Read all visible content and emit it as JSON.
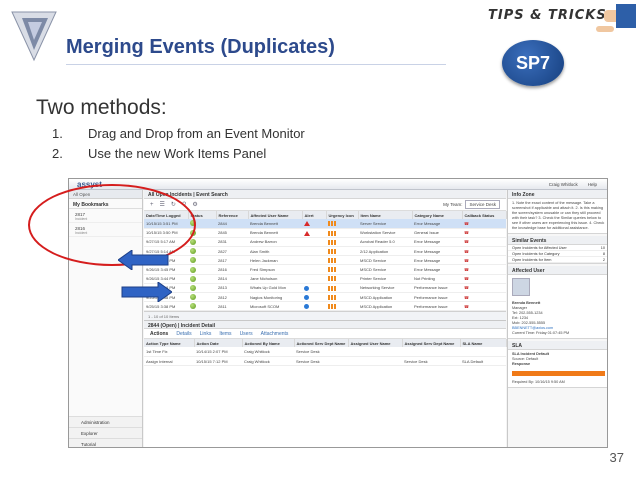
{
  "slide": {
    "title": "Merging Events (Duplicates)",
    "tips_label": "TIPS & TRICKS",
    "badge": "SP7",
    "subtitle": "Two methods:",
    "methods": [
      {
        "num": "1.",
        "text": "Drag and Drop from an Event Monitor"
      },
      {
        "num": "2.",
        "text": "Use the new Work Items Panel"
      }
    ],
    "page_number": "37"
  },
  "app": {
    "brand": "assyst",
    "user": "Craig Whitlock",
    "help": "Help",
    "left": {
      "header": "All Open",
      "bookmarks_label": "My Bookmarks",
      "saved": [
        {
          "name": "2817",
          "sub": "Incident"
        },
        {
          "name": "2816",
          "sub": "Incident"
        }
      ],
      "bottom": [
        "Administration",
        "Explorer",
        "Tutorial"
      ]
    },
    "center": {
      "title": "All Open Incidents | Event Search",
      "team_label": "My Team:",
      "team_value": "Service Desk",
      "columns": [
        "Date/Time Logged",
        "Status",
        "Reference",
        "Affected User Name",
        "Alert",
        "Urgency Icon",
        "Item Name",
        "Category Name",
        "Callback Status"
      ],
      "rows": [
        [
          "10/15/15 3:51 PM",
          "",
          "2844",
          "Brenda Bennett",
          "warn",
          "bars",
          "Server Service",
          "Error Message",
          "cb"
        ],
        [
          "10/15/15 3:50 PM",
          "",
          "2845",
          "Brenda Bennett",
          "warn",
          "bars",
          "Workstation Service",
          "General Issue",
          "cb"
        ],
        [
          "9/27/15 5:17 AM",
          "",
          "2831",
          "Andrew Barron",
          "",
          "bars",
          "Acrobat Reader 5.0",
          "Error Message",
          "cb"
        ],
        [
          "9/27/15 5:14 AM",
          "",
          "2827",
          "Alan Smith",
          "",
          "bars",
          "2/12 Application",
          "Error Message",
          "cb"
        ],
        [
          "9/26/15 3:49 PM",
          "",
          "2817",
          "Helen Jackman",
          "",
          "bars",
          "MSCD Service",
          "Error Message",
          "cb"
        ],
        [
          "9/26/15 3:45 PM",
          "",
          "2816",
          "Fred Simpson",
          "",
          "bars",
          "MSCD Service",
          "Error Message",
          "cb"
        ],
        [
          "9/26/15 3:44 PM",
          "",
          "2814",
          "Jane Nicholson",
          "",
          "bars",
          "Printer Service",
          "Not Printing",
          "cb"
        ],
        [
          "9/25/15 3:38 PM",
          "",
          "2813",
          "Whats Up Gold Mon",
          "info",
          "bars",
          "Networking Service",
          "Performance Issue",
          "cb"
        ],
        [
          "9/25/15 3:38 PM",
          "",
          "2812",
          "Nagios Monitoring",
          "info",
          "bars",
          "MSCD Application",
          "Performance Issue",
          "cb"
        ],
        [
          "9/25/15 3:38 PM",
          "",
          "2811",
          "Microsoft SCOM",
          "info",
          "bars",
          "MSCD Application",
          "Performance Issue",
          "cb"
        ]
      ],
      "pager": "1 - 10 of 10 Items",
      "detail_title": "2844 (Open) | Incident Detail",
      "tabs": [
        "Actions",
        "Details",
        "Links",
        "Items",
        "Users",
        "Attachments"
      ],
      "action_columns": [
        "Action Type Name",
        "Action Date",
        "Actioned By Name",
        "Actioned Serv Dept Name",
        "Assigned User Name",
        "Assigned Serv Dept Name",
        "SLA Name"
      ],
      "action_rows": [
        [
          "1st Time Fix",
          "10/14/15 2:07 PM",
          "Craig Whitlock",
          "Service Desk",
          "",
          "",
          ""
        ],
        [
          "Assign Internal",
          "10/15/15 7:12 PM",
          "Craig Whitlock",
          "Service Desk",
          "",
          "Service Desk",
          "SLA Default"
        ]
      ]
    },
    "right": {
      "info_title": "Info Zone",
      "info_text": "1. Note the exact content of the message. Take a screenshot if applicable and attach it. 2. Is this making the screen/system unusable or can they still proceed with their task? 3. Check the Similar queries below to see if other users are experiencing this issue. 4. Check the knowledge base for additional assistance.",
      "events_title": "Similar Events",
      "events": [
        {
          "label": "Open Incidents for Affected User",
          "count": "10"
        },
        {
          "label": "Open Incidents for Category",
          "count": "8"
        },
        {
          "label": "Open Incidents for Item",
          "count": "2"
        }
      ],
      "user_title": "Affected User",
      "user_name": "Brenda Bennett",
      "user_role": "Manager",
      "user_details": [
        "Tel: 202-555-1234",
        "Ext: 1234",
        "Mob: 202-555-5555",
        "BBENNETT@axios.com",
        "Current Time: Friday 01:07:45 PM"
      ],
      "sla_title": "SLA",
      "sla_name": "SLA Incident Default",
      "sla_source": "Source: Default",
      "sla_response": "Response",
      "sla_required": "Required By: 10/16/15 9:50 AM"
    }
  }
}
